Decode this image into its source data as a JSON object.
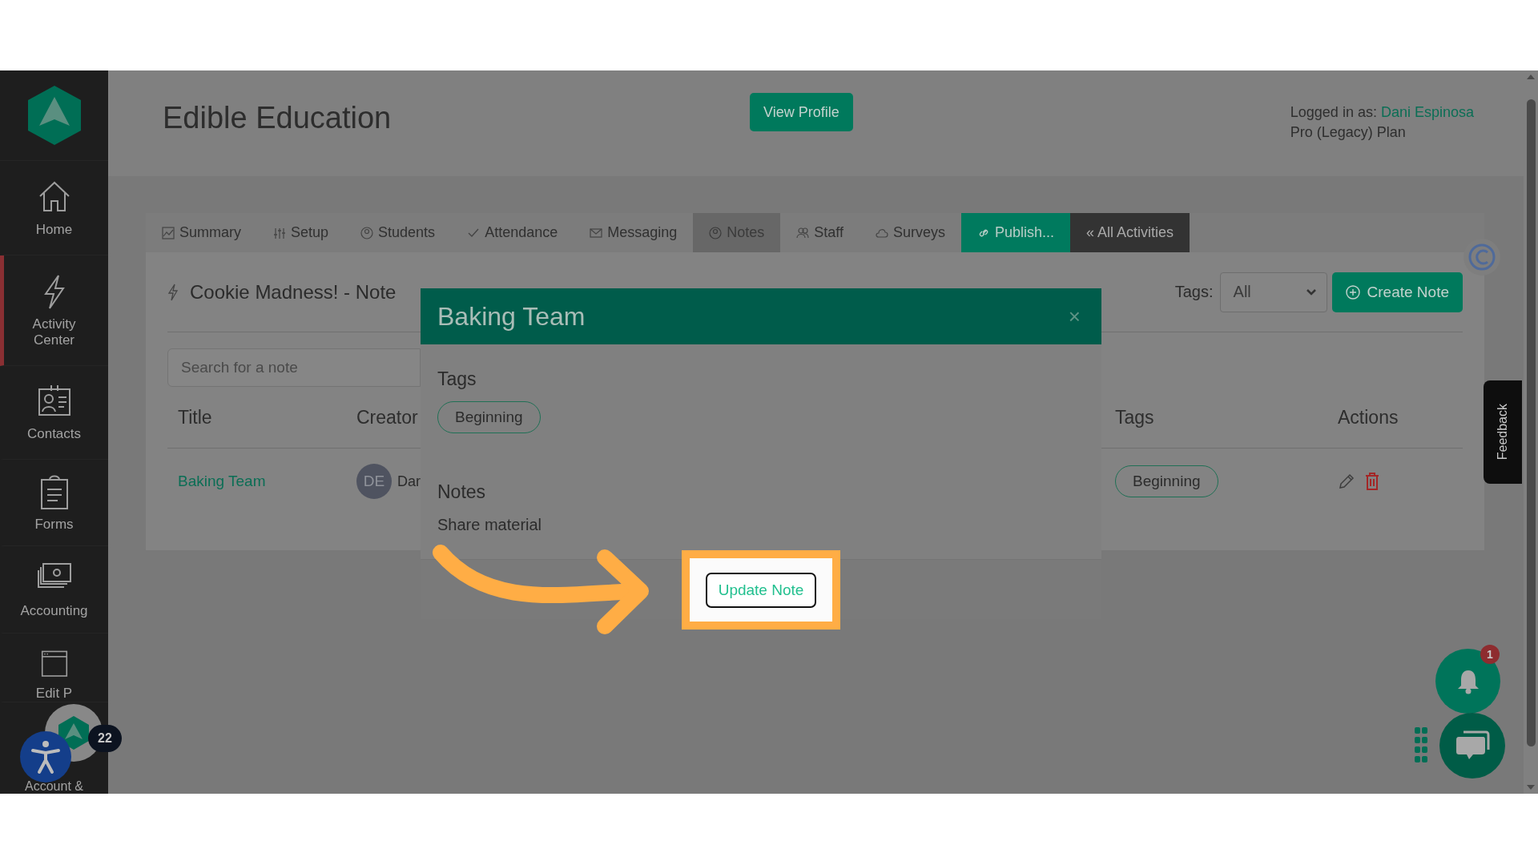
{
  "sidebar": {
    "items": [
      {
        "label": "Home",
        "selected": false
      },
      {
        "label": "Activity Center",
        "selected": true
      },
      {
        "label": "Contacts",
        "selected": false
      },
      {
        "label": "Forms",
        "selected": false
      },
      {
        "label": "Accounting",
        "selected": false
      },
      {
        "label": "Edit P",
        "selected": false
      },
      {
        "label": "Account &",
        "selected": false
      }
    ]
  },
  "header": {
    "title": "Edible Education",
    "view_profile": "View Profile",
    "logged_in_label": "Logged in as:",
    "user": "Dani Espinosa",
    "plan": "Pro (Legacy) Plan"
  },
  "tabs": [
    {
      "label": "Summary",
      "kind": "plain",
      "selected": false
    },
    {
      "label": "Setup",
      "kind": "plain",
      "selected": false
    },
    {
      "label": "Students",
      "kind": "plain",
      "selected": false
    },
    {
      "label": "Attendance",
      "kind": "plain",
      "selected": false
    },
    {
      "label": "Messaging",
      "kind": "plain",
      "selected": false
    },
    {
      "label": "Notes",
      "kind": "plain",
      "selected": true
    },
    {
      "label": "Staff",
      "kind": "plain",
      "selected": false
    },
    {
      "label": "Surveys",
      "kind": "plain",
      "selected": false
    },
    {
      "label": "Publish...",
      "kind": "accent",
      "selected": false
    },
    {
      "label": "« All Activities",
      "kind": "dark",
      "selected": false
    }
  ],
  "notes_panel": {
    "title": "Cookie Madness! - Note",
    "tags_label": "Tags:",
    "tags_filter": "All",
    "create_button": "Create Note",
    "search": {
      "placeholder": "Search for a note"
    },
    "columns": [
      "Title",
      "Creator",
      "Tags",
      "Actions"
    ],
    "rows": [
      {
        "title": "Baking Team",
        "creator_initials": "DE",
        "creator": "Dar",
        "tags": [
          "Beginning"
        ]
      }
    ]
  },
  "modal": {
    "title": "Baking Team",
    "close": "×",
    "tags_label": "Tags",
    "tags": [
      "Beginning"
    ],
    "notes_label": "Notes",
    "notes": "Share material",
    "button": "Update Note"
  },
  "widgets": {
    "badge_count": "22",
    "notifications": "1",
    "feedback": "Feedback"
  }
}
